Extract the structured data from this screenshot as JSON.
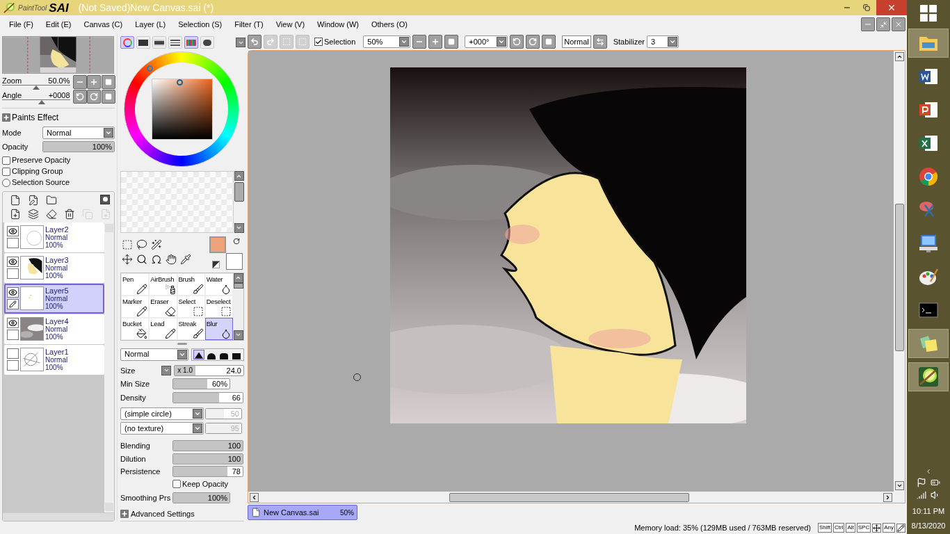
{
  "window": {
    "title": "(Not Saved)New Canvas.sai (*)",
    "logo_text": "PaintTool",
    "logo_brand": "SAI"
  },
  "menu": [
    "File (F)",
    "Edit (E)",
    "Canvas (C)",
    "Layer (L)",
    "Selection (S)",
    "Filter (T)",
    "View (V)",
    "Window (W)",
    "Others (O)"
  ],
  "navigator": {
    "zoom": {
      "label": "Zoom",
      "value": "50.0%",
      "level": 0.5
    },
    "angle": {
      "label": "Angle",
      "value": "+0008",
      "level": 0.58
    }
  },
  "paints_effect": {
    "title": "Paints Effect",
    "mode_label": "Mode",
    "mode_value": "Normal",
    "opacity": {
      "label": "Opacity",
      "value": "100%",
      "level": 1
    },
    "options": [
      {
        "kind": "checkbox",
        "label": "Preserve Opacity",
        "checked": false
      },
      {
        "kind": "checkbox",
        "label": "Clipping Group",
        "checked": false
      },
      {
        "kind": "radio",
        "label": "Selection Source",
        "checked": false
      }
    ]
  },
  "layers": [
    {
      "name": "Layer2",
      "mode": "Normal",
      "opacity": "100%",
      "visible": true,
      "selected": false
    },
    {
      "name": "Layer3",
      "mode": "Normal",
      "opacity": "100%",
      "visible": true,
      "selected": false
    },
    {
      "name": "Layer5",
      "mode": "Normal",
      "opacity": "100%",
      "visible": true,
      "selected": true
    },
    {
      "name": "Layer4",
      "mode": "Normal",
      "opacity": "100%",
      "visible": true,
      "selected": false
    },
    {
      "name": "Layer1",
      "mode": "Normal",
      "opacity": "100%",
      "visible": false,
      "selected": false
    }
  ],
  "color_tabs": [
    {
      "kind": "wheel",
      "selected": true
    },
    {
      "kind": "rgb",
      "selected": false
    },
    {
      "kind": "hsv",
      "selected": false
    },
    {
      "kind": "list",
      "selected": false
    },
    {
      "kind": "swatches",
      "selected": true
    },
    {
      "kind": "scratch",
      "selected": false
    }
  ],
  "swatches": [
    {
      "color": "#eea27b"
    },
    {
      "color": "#ffffff"
    }
  ],
  "brushes": [
    {
      "label": "Pen",
      "kind": "pen",
      "selected": false
    },
    {
      "label": "AirBrush",
      "kind": "air",
      "selected": false
    },
    {
      "label": "Brush",
      "kind": "brush",
      "selected": false
    },
    {
      "label": "Water",
      "kind": "water",
      "selected": false
    },
    {
      "label": "Marker",
      "kind": "pen",
      "selected": false
    },
    {
      "label": "Eraser",
      "kind": "eraser",
      "selected": false
    },
    {
      "label": "Select",
      "kind": "select",
      "selected": false
    },
    {
      "label": "Deselect",
      "kind": "deselect",
      "selected": false
    },
    {
      "label": "Bucket",
      "kind": "bucket",
      "selected": false
    },
    {
      "label": "Lead",
      "kind": "pen",
      "selected": false
    },
    {
      "label": "Streak",
      "kind": "brush",
      "selected": false
    },
    {
      "label": "Blur",
      "kind": "water",
      "selected": true
    }
  ],
  "brush_settings": {
    "blend": "Normal",
    "shapes": [
      {
        "selected": true
      },
      {
        "selected": false
      },
      {
        "selected": false
      },
      {
        "selected": false
      }
    ],
    "size": {
      "label": "Size",
      "multiplier": "x 1.0",
      "value": "24.0",
      "level": 0.3
    },
    "sliders_a": [
      {
        "label": "Min Size",
        "value": "60%",
        "level": 0.6
      },
      {
        "label": "Density",
        "value": "66",
        "level": 0.66
      }
    ],
    "shape": {
      "value": "(simple circle)",
      "strength": "50",
      "level": 0.5,
      "disabled": true
    },
    "texture": {
      "value": "(no texture)",
      "strength": "95",
      "level": 0.95,
      "disabled": true
    },
    "sliders_b": [
      {
        "label": "Blending",
        "value": "100",
        "level": 1
      },
      {
        "label": "Dilution",
        "value": "100",
        "level": 1
      },
      {
        "label": "Persistence",
        "value": "78",
        "level": 0.78
      }
    ],
    "keep_opacity": {
      "label": "Keep Opacity",
      "checked": false
    },
    "smoothing": {
      "label": "Smoothing Prs",
      "value": "100%",
      "level": 1
    },
    "advanced": "Advanced Settings"
  },
  "toolbar": {
    "history": [
      {
        "kind": "undo",
        "disabled": false
      },
      {
        "kind": "redo",
        "disabled": true
      },
      {
        "kind": "sel-a",
        "disabled": true
      },
      {
        "kind": "sel-b",
        "disabled": true
      }
    ],
    "selection": {
      "label": "Selection",
      "checked": true
    },
    "zoom": "50%",
    "angle": "+000°",
    "blend": "Normal",
    "stabilizer_label": "Stabilizer",
    "stabilizer": "3"
  },
  "canvas_tab": {
    "name": "New Canvas.sai",
    "zoom": "50%",
    "selected": true
  },
  "status": {
    "memory": "Memory load: 35% (129MB used / 763MB reserved)",
    "keys": [
      "Shift",
      "Ctrl",
      "Alt",
      "SPC",
      "Any"
    ]
  },
  "taskbar": {
    "apps": [
      {
        "kind": "explorer",
        "active": true
      },
      {
        "kind": "word",
        "active": false
      },
      {
        "kind": "powerpoint",
        "active": false
      },
      {
        "kind": "excel",
        "active": false
      },
      {
        "kind": "chrome",
        "active": false
      },
      {
        "kind": "snip",
        "active": false
      },
      {
        "kind": "keyboard",
        "active": false
      },
      {
        "kind": "paint",
        "active": false
      },
      {
        "kind": "cmd",
        "active": false
      },
      {
        "kind": "notes",
        "active": true
      },
      {
        "kind": "sai",
        "active": true
      }
    ],
    "time": "10:11 PM",
    "date": "8/13/2020"
  }
}
